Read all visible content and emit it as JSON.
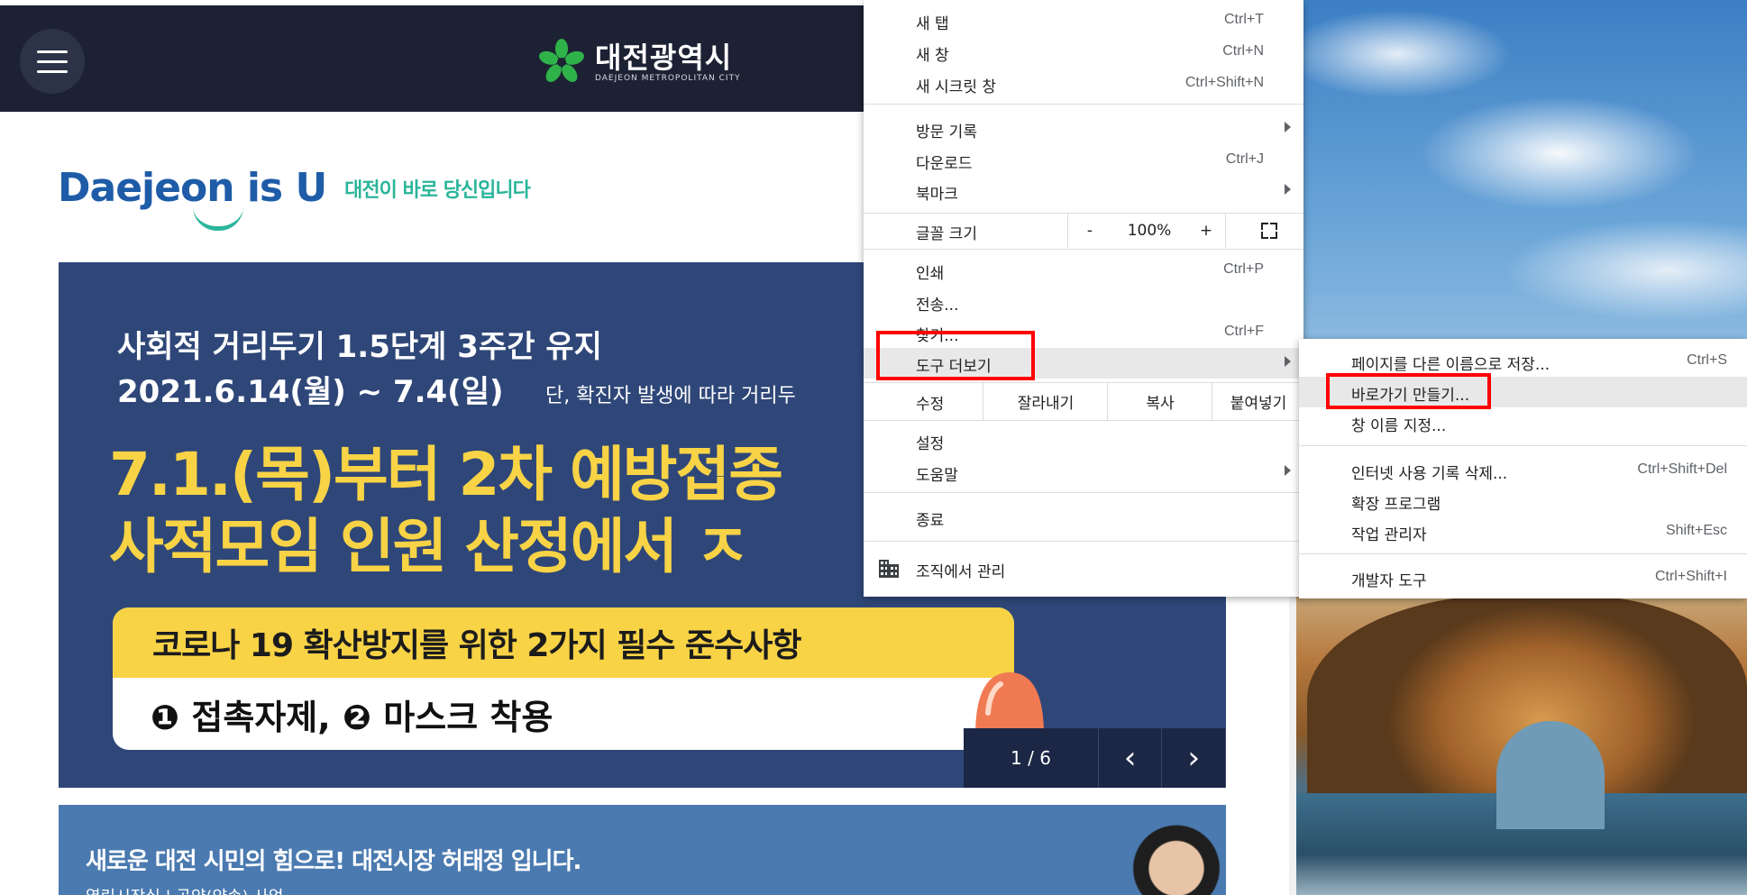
{
  "site": {
    "logo_ko": "대전광역시",
    "logo_en": "DAEJEON METROPOLITAN CITY",
    "slogan_main": "Daejeon is U",
    "slogan_sub": "대전이 바로 당신입니다"
  },
  "banner": {
    "line1": "사회적 거리두기 1.5단계 3주간 유지",
    "line2": "2021.6.14(월) ~ 7.4(일)",
    "note": "단, 확진자 발생에 따라 거리두",
    "big1": "7.1.(목)부터 2차 예방접종",
    "big2": "사적모임 인원 산정에서 ㅈ",
    "box_title": "코로나 19 확산방지를 위한 2가지 필수 준수사항",
    "box_body": "❶ 접촉자제, ❷ 마스크 착용",
    "pager_count": "1 / 6",
    "prev_icon": "‹",
    "next_icon": "›"
  },
  "mayor": {
    "text": "새로운 대전 시민의 힘으로! 대전시장 허태정 입니다.",
    "sub": "열린시장실  |  공약(약속) 사업"
  },
  "menu": {
    "new_tab": "새 탭",
    "new_tab_sc": "Ctrl+T",
    "new_window": "새 창",
    "new_window_sc": "Ctrl+N",
    "incognito": "새 시크릿 창",
    "incognito_sc": "Ctrl+Shift+N",
    "history": "방문 기록",
    "downloads": "다운로드",
    "downloads_sc": "Ctrl+J",
    "bookmarks": "북마크",
    "font_size": "글꼴 크기",
    "zoom_minus": "-",
    "zoom_value": "100%",
    "zoom_plus": "+",
    "print": "인쇄",
    "print_sc": "Ctrl+P",
    "cast": "전송...",
    "find": "찾기...",
    "find_sc": "Ctrl+F",
    "more_tools": "도구 더보기",
    "edit": "수정",
    "cut": "잘라내기",
    "copy": "복사",
    "paste": "붙여넣기",
    "settings": "설정",
    "help": "도움말",
    "exit": "종료",
    "managed": "조직에서 관리"
  },
  "submenu": {
    "save_page": "페이지를 다른 이름으로 저장...",
    "save_page_sc": "Ctrl+S",
    "create_shortcut": "바로가기 만들기...",
    "name_window": "창 이름 지정...",
    "clear_browsing": "인터넷 사용 기록 삭제...",
    "clear_browsing_sc": "Ctrl+Shift+Del",
    "extensions": "확장 프로그램",
    "task_manager": "작업 관리자",
    "task_manager_sc": "Shift+Esc",
    "dev_tools": "개발자 도구",
    "dev_tools_sc": "Ctrl+Shift+I"
  },
  "colors": {
    "header_bg": "#1c2233",
    "banner_bg": "#2f4778",
    "banner_yellow": "#f8d346",
    "highlight_red": "#ff0000"
  }
}
